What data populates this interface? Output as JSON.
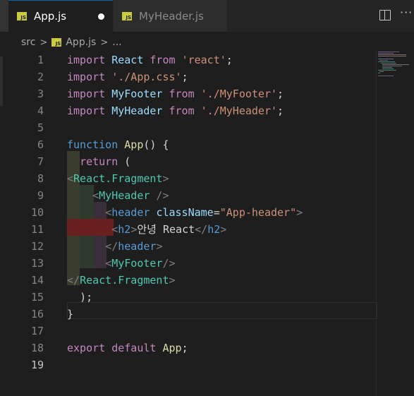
{
  "tabs": [
    {
      "name": "App.js",
      "badge": "JS",
      "active": true,
      "dirty": true
    },
    {
      "name": "MyHeader.js",
      "badge": "JS",
      "active": false,
      "dirty": false
    }
  ],
  "toolbar": {
    "split_icon": "split-editor-icon",
    "more_icon": "more-actions-icon",
    "more_glyph": "···"
  },
  "breadcrumb": {
    "folder": "src",
    "badge": "JS",
    "file": "App.js",
    "symbol": "..."
  },
  "editor": {
    "current_line": 19,
    "lines": [
      {
        "n": "1"
      },
      {
        "n": "2"
      },
      {
        "n": "3"
      },
      {
        "n": "4"
      },
      {
        "n": "5"
      },
      {
        "n": "6"
      },
      {
        "n": "7"
      },
      {
        "n": "8"
      },
      {
        "n": "9"
      },
      {
        "n": "10"
      },
      {
        "n": "11"
      },
      {
        "n": "12"
      },
      {
        "n": "13"
      },
      {
        "n": "14"
      },
      {
        "n": "15"
      },
      {
        "n": "16"
      },
      {
        "n": "17"
      },
      {
        "n": "18"
      },
      {
        "n": "19"
      }
    ],
    "tokens": {
      "import": "import",
      "from": "from",
      "react_id": "React",
      "react_str": "'react'",
      "semicolon": ";",
      "app_css": "'./App.css'",
      "myfooter_id": "MyFooter",
      "myfooter_str": "'./MyFooter'",
      "myheader_id": "MyHeader",
      "myheader_str": "'./MyHeader'",
      "function": "function",
      "app_fn": "App",
      "paren_brace": "() {",
      "return": "return",
      "open_paren": "(",
      "lt": "<",
      "gt": ">",
      "react_fragment": "React.Fragment",
      "self_close": " />",
      "self_close_tight": "/>",
      "close_lt": "</",
      "header": "header",
      "classname": "className",
      "eq": "=",
      "app_header_str": "\"App-header\"",
      "h2": "h2",
      "h2_text": "안녕 React",
      "close_paren": ");",
      "close_brace": "}",
      "export": "export",
      "default": "default",
      "app_id": "App"
    }
  }
}
